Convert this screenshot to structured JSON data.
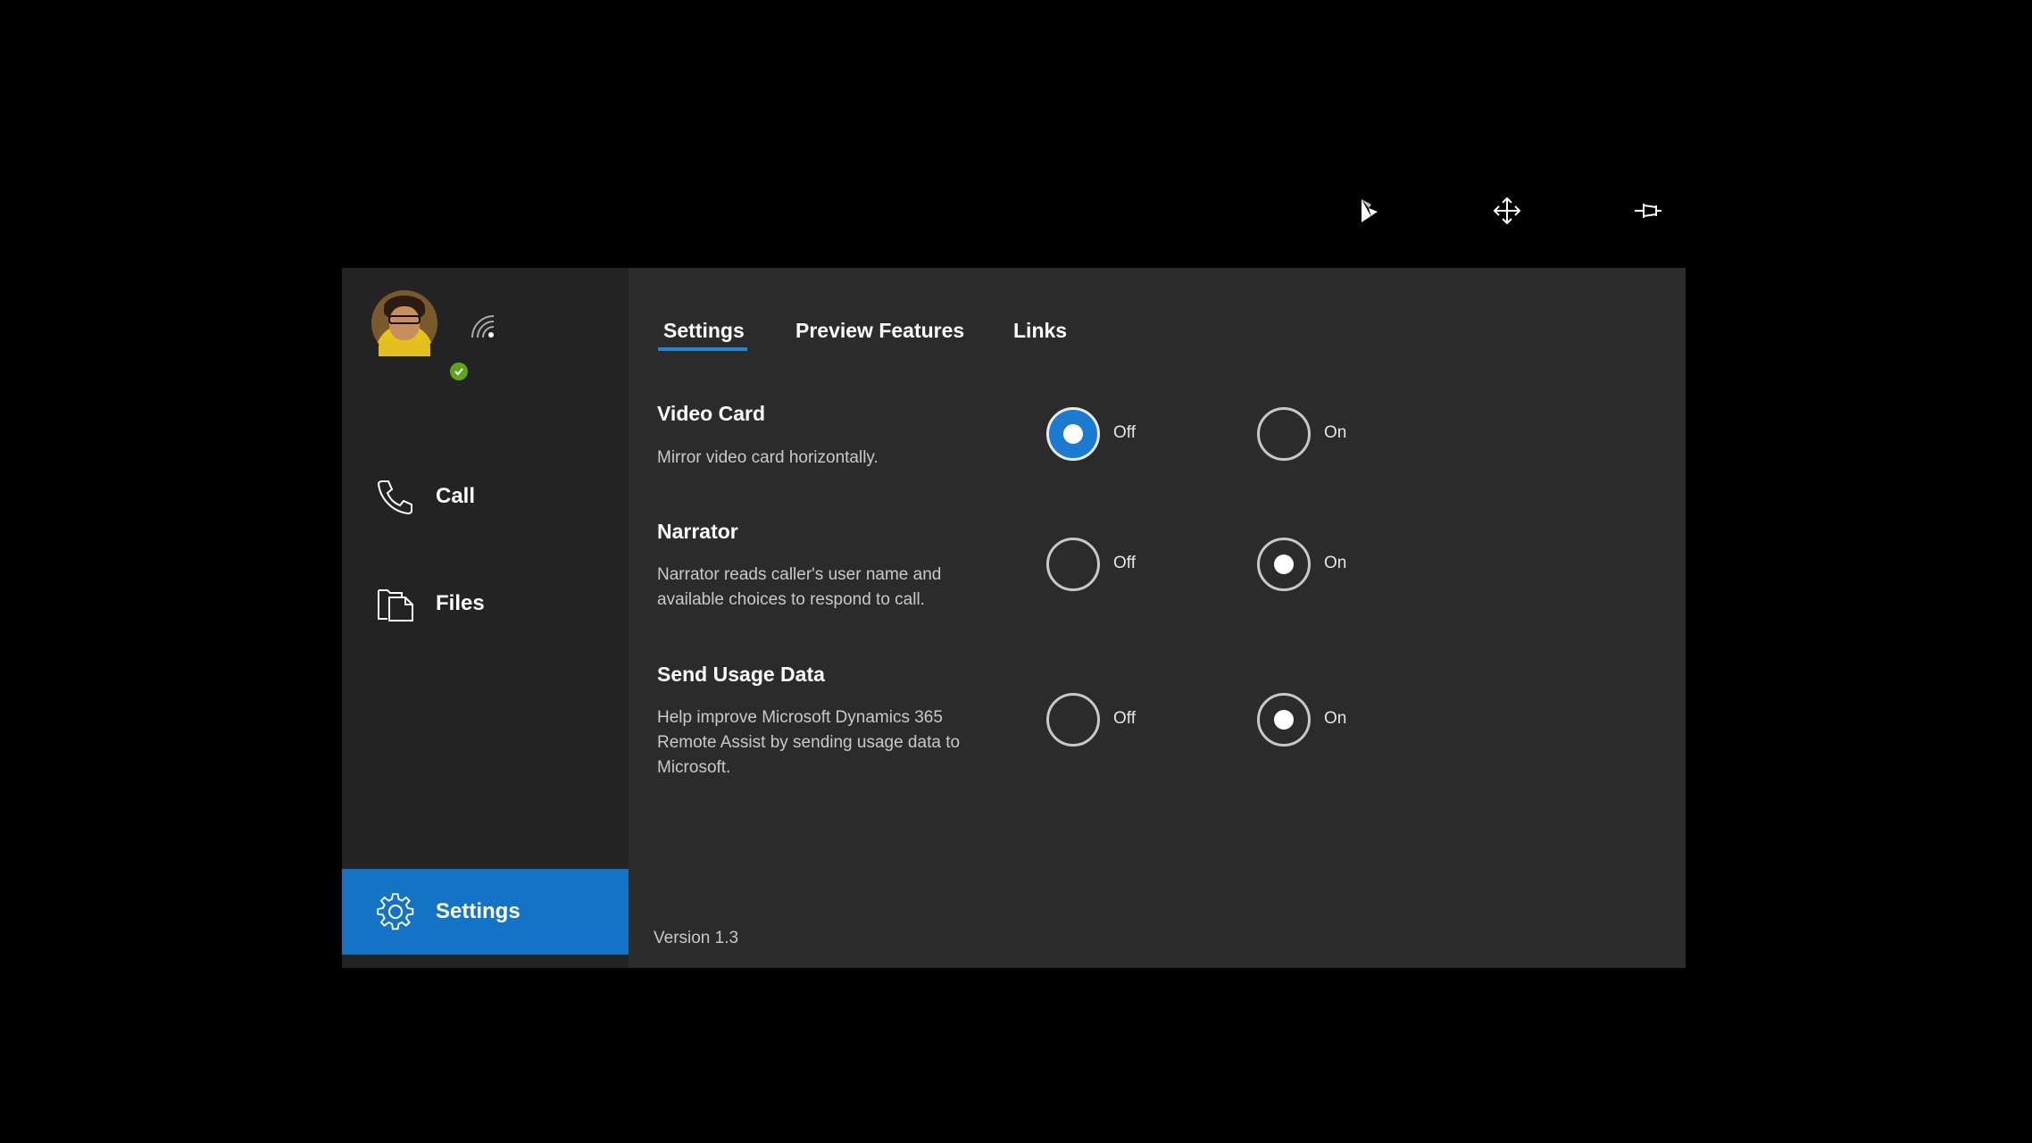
{
  "topbar": {
    "icons": [
      "dynamics-logo-icon",
      "move-icon",
      "pin-icon"
    ]
  },
  "sidebar": {
    "presence_color": "#5ea51b",
    "items": [
      {
        "label": "Call",
        "icon": "phone-icon"
      },
      {
        "label": "Files",
        "icon": "files-icon"
      },
      {
        "label": "Settings",
        "icon": "gear-icon",
        "active": true
      }
    ],
    "active_color": "#1473c5"
  },
  "tabs": [
    {
      "label": "Settings",
      "active": true
    },
    {
      "label": "Preview Features"
    },
    {
      "label": "Links"
    }
  ],
  "settings": [
    {
      "title": "Video Card",
      "description": "Mirror video card horizontally.",
      "off_label": "Off",
      "on_label": "On",
      "value": "Off"
    },
    {
      "title": "Narrator",
      "description": "Narrator reads caller's user name and available choices to respond to call.",
      "off_label": "Off",
      "on_label": "On",
      "value": "On"
    },
    {
      "title": "Send Usage Data",
      "description": "Help improve Microsoft Dynamics 365 Remote Assist by sending usage data to Microsoft.",
      "off_label": "Off",
      "on_label": "On",
      "value": "On"
    }
  ],
  "version": "Version 1.3",
  "accent_color": "#1f86d8"
}
